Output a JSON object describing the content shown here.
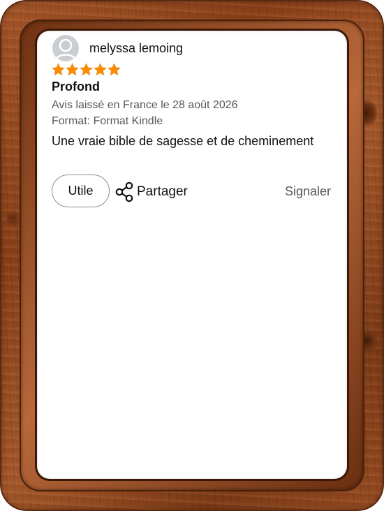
{
  "review": {
    "author": "melyssa lemoing",
    "rating": 5,
    "rating_max": 5,
    "title": "Profond",
    "date_line": "Avis laissé en France le 28 août 2026",
    "format_line": "Format: Format Kindle",
    "body": "Une vraie bible de sagesse et de cheminement"
  },
  "actions": {
    "helpful_label": "Utile",
    "share_label": "Partager",
    "report_label": "Signaler"
  },
  "icons": {
    "avatar": "user-avatar-icon",
    "star": "star-icon",
    "share": "share-icon"
  },
  "colors": {
    "star": "#ff8c00",
    "text": "#0f1111",
    "muted": "#565959",
    "button_border": "#888c8c"
  }
}
